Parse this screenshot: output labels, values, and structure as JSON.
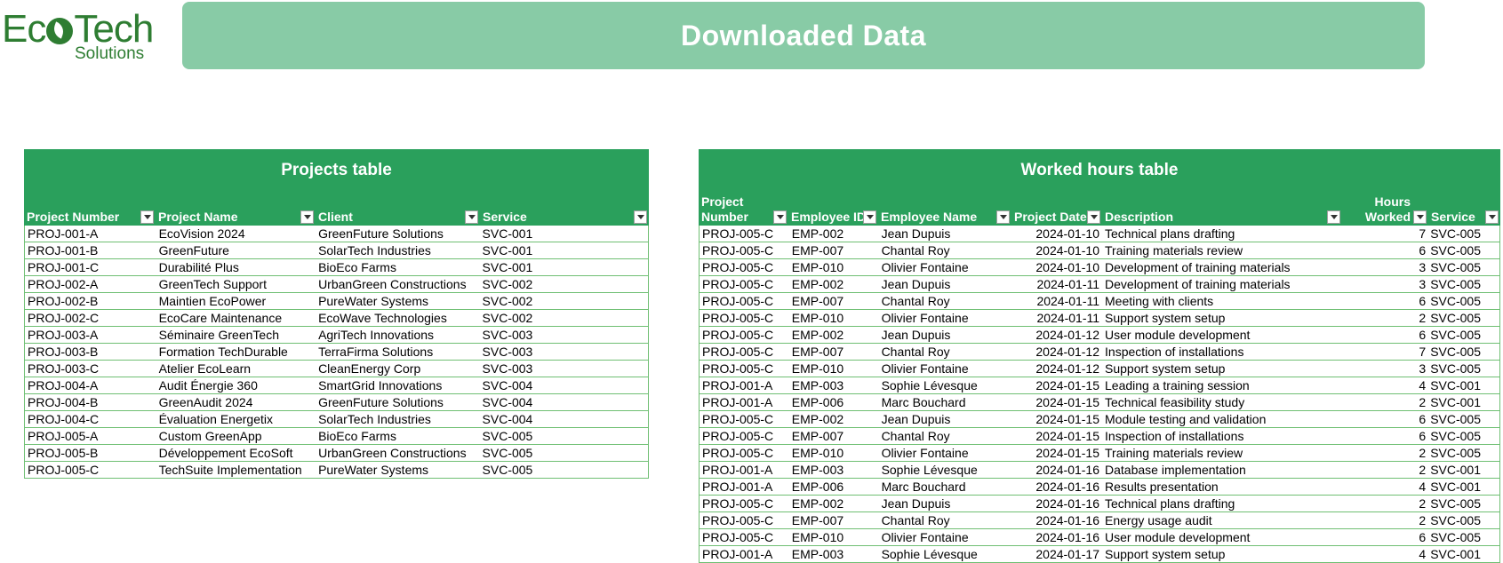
{
  "logo": {
    "main_before": "Ec",
    "main_after": "Tech",
    "sub": "Solutions"
  },
  "banner": {
    "title": "Downloaded Data"
  },
  "colors": {
    "brand_green": "#2e7d32",
    "banner": "#88cba6",
    "table_header": "#2aa05c",
    "grid": "#6fbf73"
  },
  "projects": {
    "title": "Projects table",
    "headers": [
      "Project Number",
      "Project Name",
      "Client",
      "Service"
    ],
    "rows": [
      [
        "PROJ-001-A",
        "EcoVision 2024",
        "GreenFuture Solutions",
        "SVC-001"
      ],
      [
        "PROJ-001-B",
        "GreenFuture",
        "SolarTech Industries",
        "SVC-001"
      ],
      [
        "PROJ-001-C",
        "Durabilité Plus",
        "BioEco Farms",
        "SVC-001"
      ],
      [
        "PROJ-002-A",
        "GreenTech Support",
        "UrbanGreen Constructions",
        "SVC-002"
      ],
      [
        "PROJ-002-B",
        "Maintien EcoPower",
        "PureWater Systems",
        "SVC-002"
      ],
      [
        "PROJ-002-C",
        "EcoCare Maintenance",
        "EcoWave Technologies",
        "SVC-002"
      ],
      [
        "PROJ-003-A",
        "Séminaire GreenTech",
        "AgriTech Innovations",
        "SVC-003"
      ],
      [
        "PROJ-003-B",
        "Formation TechDurable",
        "TerraFirma Solutions",
        "SVC-003"
      ],
      [
        "PROJ-003-C",
        "Atelier EcoLearn",
        "CleanEnergy Corp",
        "SVC-003"
      ],
      [
        "PROJ-004-A",
        "Audit Énergie 360",
        "SmartGrid Innovations",
        "SVC-004"
      ],
      [
        "PROJ-004-B",
        "GreenAudit 2024",
        "GreenFuture Solutions",
        "SVC-004"
      ],
      [
        "PROJ-004-C",
        "Évaluation Energetix",
        "SolarTech Industries",
        "SVC-004"
      ],
      [
        "PROJ-005-A",
        "Custom GreenApp",
        "BioEco Farms",
        "SVC-005"
      ],
      [
        "PROJ-005-B",
        "Développement EcoSoft",
        "UrbanGreen Constructions",
        "SVC-005"
      ],
      [
        "PROJ-005-C",
        "TechSuite Implementation",
        "PureWater Systems",
        "SVC-005"
      ]
    ]
  },
  "hours": {
    "title": "Worked hours table",
    "headers": [
      "Project\nNumber",
      "Employee ID",
      "Employee Name",
      "Project Date",
      "Description",
      "Hours\nWorked",
      "Service"
    ],
    "rows": [
      [
        "PROJ-005-C",
        "EMP-002",
        "Jean Dupuis",
        "2024-01-10",
        "Technical plans drafting",
        "7",
        "SVC-005"
      ],
      [
        "PROJ-005-C",
        "EMP-007",
        "Chantal Roy",
        "2024-01-10",
        "Training materials review",
        "6",
        "SVC-005"
      ],
      [
        "PROJ-005-C",
        "EMP-010",
        "Olivier Fontaine",
        "2024-01-10",
        "Development of training materials",
        "3",
        "SVC-005"
      ],
      [
        "PROJ-005-C",
        "EMP-002",
        "Jean Dupuis",
        "2024-01-11",
        "Development of training materials",
        "3",
        "SVC-005"
      ],
      [
        "PROJ-005-C",
        "EMP-007",
        "Chantal Roy",
        "2024-01-11",
        "Meeting with clients",
        "6",
        "SVC-005"
      ],
      [
        "PROJ-005-C",
        "EMP-010",
        "Olivier Fontaine",
        "2024-01-11",
        "Support system setup",
        "2",
        "SVC-005"
      ],
      [
        "PROJ-005-C",
        "EMP-002",
        "Jean Dupuis",
        "2024-01-12",
        "User module development",
        "6",
        "SVC-005"
      ],
      [
        "PROJ-005-C",
        "EMP-007",
        "Chantal Roy",
        "2024-01-12",
        "Inspection of installations",
        "7",
        "SVC-005"
      ],
      [
        "PROJ-005-C",
        "EMP-010",
        "Olivier Fontaine",
        "2024-01-12",
        "Support system setup",
        "3",
        "SVC-005"
      ],
      [
        "PROJ-001-A",
        "EMP-003",
        "Sophie Lévesque",
        "2024-01-15",
        "Leading a training session",
        "4",
        "SVC-001"
      ],
      [
        "PROJ-001-A",
        "EMP-006",
        "Marc Bouchard",
        "2024-01-15",
        "Technical feasibility study",
        "2",
        "SVC-001"
      ],
      [
        "PROJ-005-C",
        "EMP-002",
        "Jean Dupuis",
        "2024-01-15",
        "Module testing and validation",
        "6",
        "SVC-005"
      ],
      [
        "PROJ-005-C",
        "EMP-007",
        "Chantal Roy",
        "2024-01-15",
        "Inspection of installations",
        "6",
        "SVC-005"
      ],
      [
        "PROJ-005-C",
        "EMP-010",
        "Olivier Fontaine",
        "2024-01-15",
        "Training materials review",
        "2",
        "SVC-005"
      ],
      [
        "PROJ-001-A",
        "EMP-003",
        "Sophie Lévesque",
        "2024-01-16",
        "Database implementation",
        "2",
        "SVC-001"
      ],
      [
        "PROJ-001-A",
        "EMP-006",
        "Marc Bouchard",
        "2024-01-16",
        "Results presentation",
        "4",
        "SVC-001"
      ],
      [
        "PROJ-005-C",
        "EMP-002",
        "Jean Dupuis",
        "2024-01-16",
        "Technical plans drafting",
        "2",
        "SVC-005"
      ],
      [
        "PROJ-005-C",
        "EMP-007",
        "Chantal Roy",
        "2024-01-16",
        "Energy usage audit",
        "2",
        "SVC-005"
      ],
      [
        "PROJ-005-C",
        "EMP-010",
        "Olivier Fontaine",
        "2024-01-16",
        "User module development",
        "6",
        "SVC-005"
      ],
      [
        "PROJ-001-A",
        "EMP-003",
        "Sophie Lévesque",
        "2024-01-17",
        "Support system setup",
        "4",
        "SVC-001"
      ]
    ]
  }
}
